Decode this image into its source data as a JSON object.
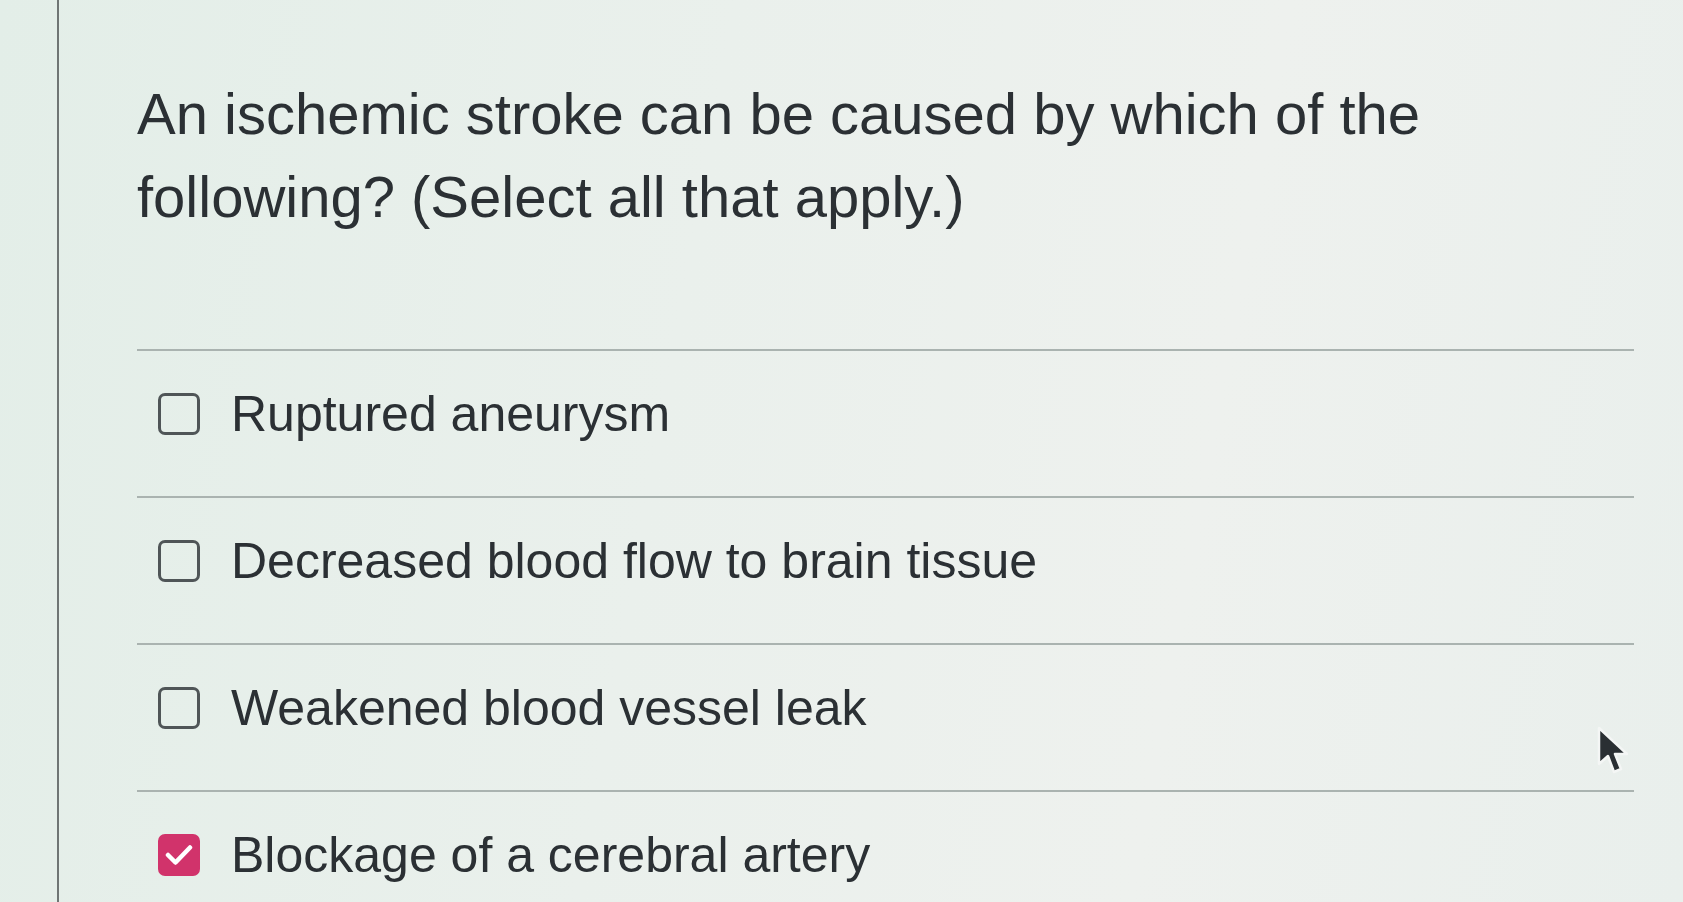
{
  "question": "An ischemic stroke can be caused by which of the following? (Select all that apply.)",
  "options": [
    {
      "label": "Ruptured aneurysm",
      "checked": false
    },
    {
      "label": "Decreased blood flow to brain tissue",
      "checked": false
    },
    {
      "label": "Weakened blood vessel leak",
      "checked": false
    },
    {
      "label": "Blockage of a cerebral artery",
      "checked": true
    }
  ]
}
